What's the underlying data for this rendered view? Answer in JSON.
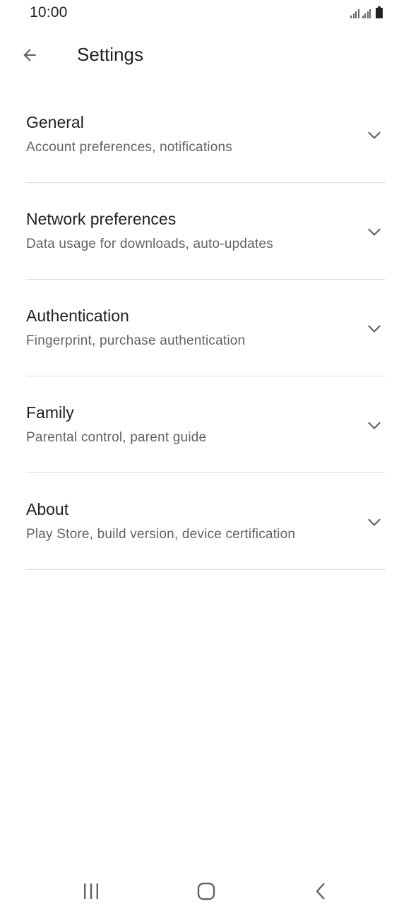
{
  "status_bar": {
    "time": "10:00",
    "icons": [
      "signal-icon",
      "signal-icon",
      "battery-icon"
    ]
  },
  "app_bar": {
    "back_icon": "arrow-back-icon",
    "title": "Settings"
  },
  "settings": {
    "items": [
      {
        "title": "General",
        "subtitle": "Account preferences, notifications",
        "icon": "chevron-down-icon"
      },
      {
        "title": "Network preferences",
        "subtitle": "Data usage for downloads, auto-updates",
        "icon": "chevron-down-icon"
      },
      {
        "title": "Authentication",
        "subtitle": "Fingerprint, purchase authentication",
        "icon": "chevron-down-icon"
      },
      {
        "title": "Family",
        "subtitle": "Parental control, parent guide",
        "icon": "chevron-down-icon"
      },
      {
        "title": "About",
        "subtitle": "Play Store, build version, device certification",
        "icon": "chevron-down-icon"
      }
    ]
  },
  "nav_bar": {
    "buttons": [
      "recents-icon",
      "home-icon",
      "back-icon"
    ]
  },
  "colors": {
    "background": "#ffffff",
    "text_primary": "#202124",
    "text_secondary": "#5f6368",
    "divider": "#dadce0"
  }
}
